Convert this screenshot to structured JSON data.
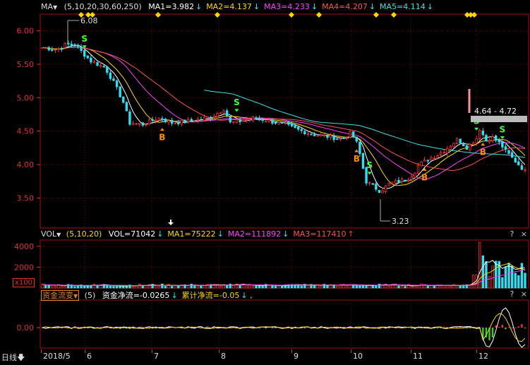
{
  "chart_data": [
    {
      "type": "candlestick",
      "header": {
        "indicator": "MA",
        "params": "(5,10,20,30,60,250)",
        "values": [
          {
            "label": "MA1=3.982",
            "color": "#ffffff"
          },
          {
            "label": "MA2=4.137",
            "color": "#ffd700"
          },
          {
            "label": "MA3=4.233",
            "color": "#ff40ff"
          },
          {
            "label": "MA4=4.207",
            "color": "#ff5050"
          },
          {
            "label": "MA5=4.114",
            "color": "#40e0e0"
          }
        ]
      },
      "y_ticks": [
        "6.00",
        "5.50",
        "5.00",
        "4.50",
        "4.00",
        "3.50"
      ],
      "ylim": [
        3.05,
        6.25
      ],
      "annotations": {
        "high": "6.08",
        "low": "3.23",
        "range": "4.64 - 4.72",
        "buy_signal": "B",
        "sell_signal": "S"
      },
      "signals": [
        {
          "type": "S",
          "x": 0.09
        },
        {
          "type": "B",
          "x": 0.25
        },
        {
          "type": "S",
          "x": 0.4
        },
        {
          "type": "B",
          "x": 0.65
        },
        {
          "type": "S",
          "x": 0.68
        },
        {
          "type": "B",
          "x": 0.79
        },
        {
          "type": "S",
          "x": 0.9
        },
        {
          "type": "B",
          "x": 0.91
        },
        {
          "type": "S",
          "x": 0.95
        }
      ]
    },
    {
      "type": "bar",
      "header": {
        "indicator": "VOL",
        "params": "(5,10,20)",
        "values": [
          {
            "label": "VOL=71042",
            "color": "#ffffff"
          },
          {
            "label": "MA1=75222",
            "color": "#ffd700"
          },
          {
            "label": "MA2=111892",
            "color": "#ff40ff"
          },
          {
            "label": "MA3=117410",
            "color": "#ff5050"
          }
        ]
      },
      "y_ticks": [
        "4000",
        "2000"
      ],
      "unit_label": "x100",
      "ylim": [
        0,
        4600
      ]
    },
    {
      "type": "bar",
      "header": {
        "indicator": "资金流变",
        "params": "(5)",
        "values": [
          {
            "label": "资金净流=-0.0265",
            "color": "#ffffff"
          },
          {
            "label": "累计净流=-0.05",
            "color": "#ffd700"
          }
        ],
        "trailing": ","
      },
      "y_ticks": [
        "0.00"
      ]
    }
  ],
  "x_axis": {
    "period_button": "日线",
    "labels": [
      "2018/5",
      "6",
      "7",
      "8",
      "9",
      "10",
      "11",
      "12"
    ]
  },
  "panel_controls": [
    "?",
    "×"
  ],
  "colors": {
    "up": "#ff3030",
    "down": "#30e0f0",
    "grid": "#8b0000",
    "axis_text": "#e03030",
    "signal_s": "#40ff40",
    "signal_b": "#ff8c00"
  }
}
